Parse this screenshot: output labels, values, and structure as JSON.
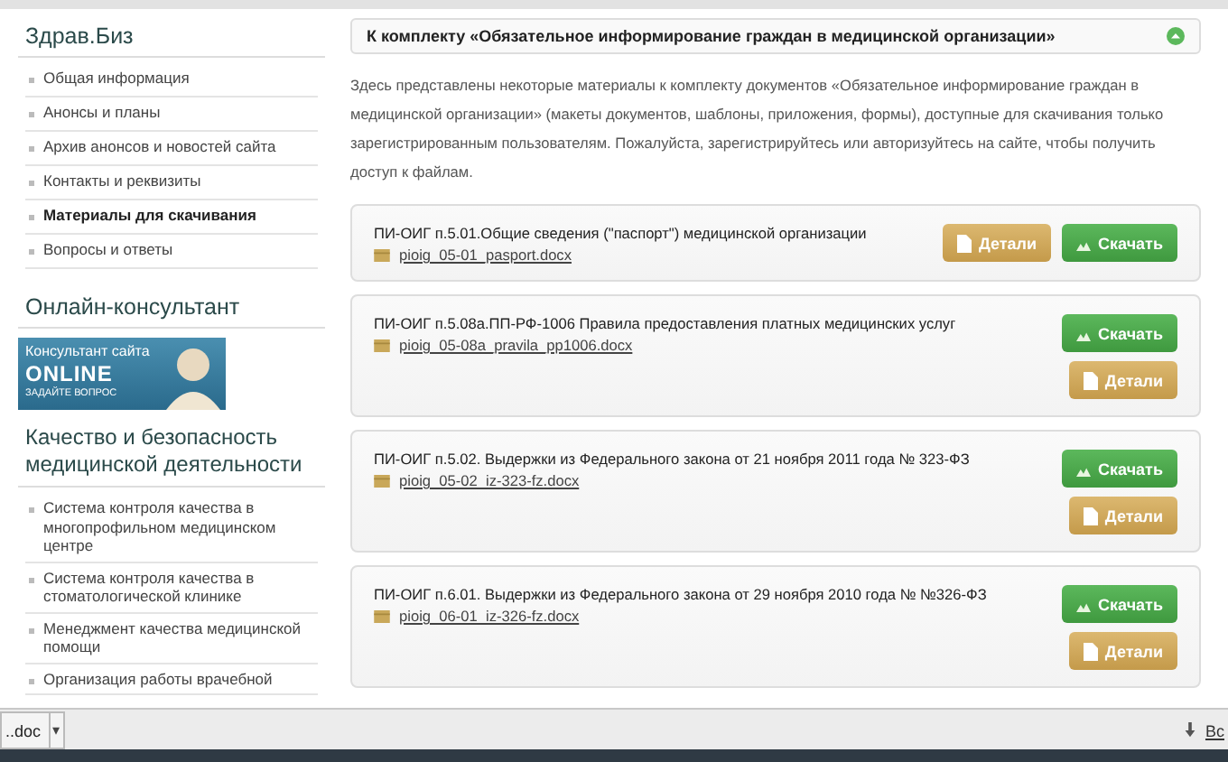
{
  "sidebar": {
    "title": "Здрав.Биз",
    "items": [
      {
        "label": "Общая информация",
        "selected": false
      },
      {
        "label": "Анонсы и планы",
        "selected": false
      },
      {
        "label": "Архив анонсов и новостей сайта",
        "selected": false
      },
      {
        "label": "Контакты и реквизиты",
        "selected": false
      },
      {
        "label": "Материалы для скачивания",
        "selected": true
      },
      {
        "label": "Вопросы и ответы",
        "selected": false
      }
    ],
    "consultant": {
      "title": "Онлайн-консультант",
      "banner_line_1": "Консультант сайта",
      "banner_line_2": "ONLINE",
      "banner_line_3": "ЗАДАЙТЕ ВОПРОС"
    },
    "quality": {
      "title": "Качество и безопасность медицинской деятельности",
      "items": [
        "Система контроля качества в многопрофильном медицинском центре",
        "Система контроля качества в стоматологической клинике",
        "Менеджмент качества медицинской помощи",
        "Организация работы врачебной"
      ]
    }
  },
  "main": {
    "header": "К комплекту «Обязательное информирование граждан в медицинской организации»",
    "intro": "Здесь представлены некоторые материалы к комплекту документов «Обязательное информирование граждан в медицинской организации» (макеты документов, шаблоны, приложения, формы), доступные для скачивания только зарегистрированным пользователям. Пожалуйста, зарегистрируйтесь или авторизуйтесь на сайте, чтобы получить доступ к файлам.",
    "documents": [
      {
        "kind": "inline",
        "title": "ПИ-ОИГ п.5.01.Общие сведения (\"паспорт\") медицинской организации",
        "file": "pioig_05-01_pasport.docx",
        "details": "Детали",
        "download": "Скачать"
      },
      {
        "kind": "stacked",
        "title": "ПИ-ОИГ п.5.08а.ПП-РФ-1006 Правила предоставления платных медицинских услуг",
        "file": "pioig_05-08a_pravila_pp1006.docx",
        "details": "Детали",
        "download": "Скачать"
      },
      {
        "kind": "stacked",
        "title": "ПИ-ОИГ п.5.02. Выдержки из Федерального закона от 21 ноября 2011 года № 323-ФЗ",
        "file": "pioig_05-02_iz-323-fz.docx",
        "details": "Детали",
        "download": "Скачать"
      },
      {
        "kind": "stacked",
        "title": "ПИ-ОИГ п.6.01. Выдержки из Федерального закона от 29 ноября 2010 года № №326-ФЗ",
        "file": "pioig_06-01_iz-326-fz.docx",
        "details": "Детали",
        "download": "Скачать"
      }
    ]
  },
  "download_bar": {
    "file": "..doc",
    "menu": "▾",
    "show_all": "Вс"
  }
}
